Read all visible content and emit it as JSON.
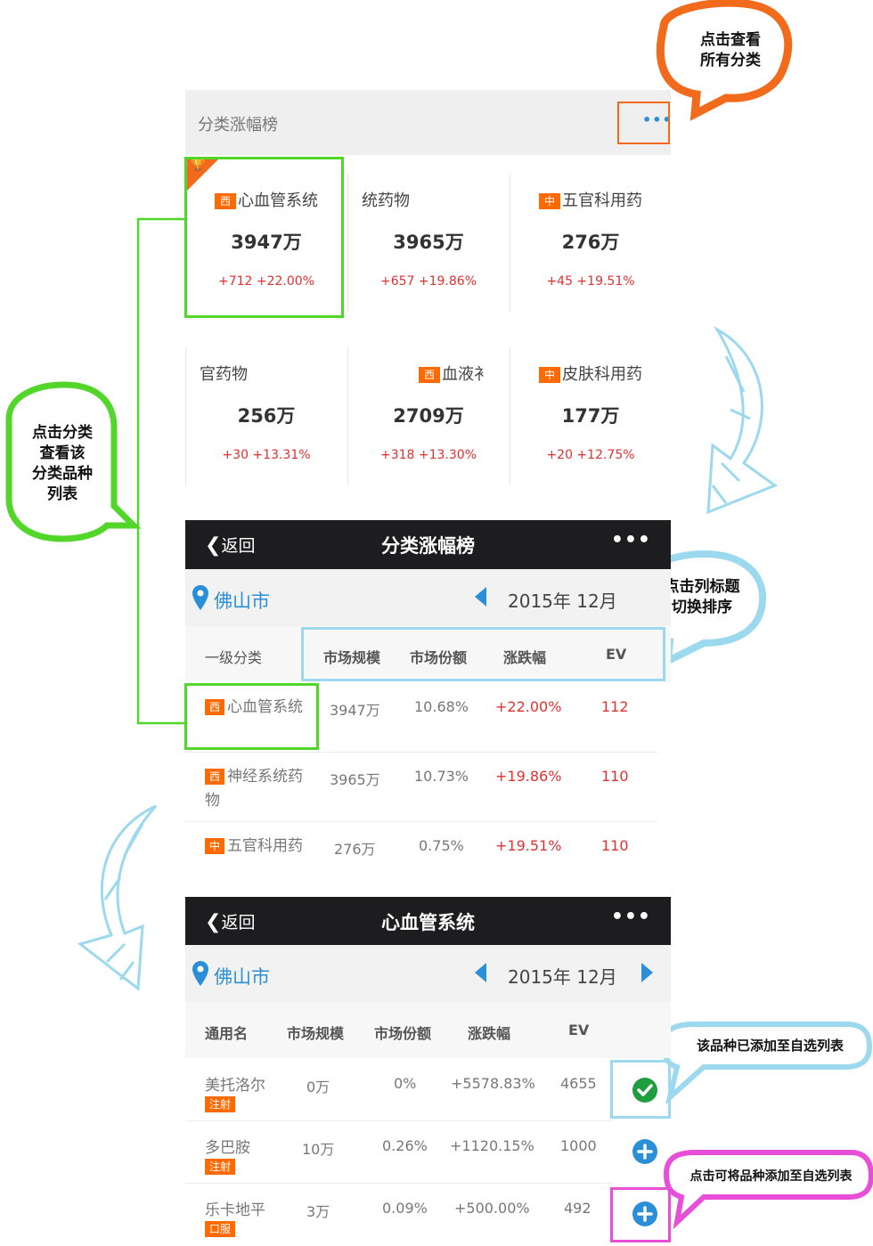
{
  "callouts": {
    "top_right": [
      "点击查看",
      "所有分类"
    ],
    "left": [
      "点击分类",
      "查看该",
      "分类品种",
      "列表"
    ],
    "col_sort": [
      "点击列标题",
      "切换排序"
    ],
    "added": "该品种已添加至自选列表",
    "add": "点击可将品种添加至自选列表"
  },
  "section1": {
    "title": "分类涨幅榜",
    "more_glyph": "•••",
    "cards": [
      {
        "tag": "西",
        "name": "心血管系统",
        "value": "3947万",
        "change": "+712  +22.00%"
      },
      {
        "tag": "",
        "name": "统药物",
        "value": "3965万",
        "change": "+657  +19.86%"
      },
      {
        "tag": "中",
        "name": "五官科用药",
        "value": "276万",
        "change": "+45  +19.51%"
      },
      {
        "tag": "",
        "name": "官药物",
        "value": "256万",
        "change": "+30  +13.31%"
      },
      {
        "tag": "西",
        "name": "血液衤",
        "value": "2709万",
        "change": "+318  +13.30%"
      },
      {
        "tag": "中",
        "name": "皮肤科用药",
        "value": "177万",
        "change": "+20  +12.75%"
      }
    ]
  },
  "section2": {
    "back": "返回",
    "title": "分类涨幅榜",
    "dots": "•••",
    "city": "佛山市",
    "month": "2015年 12月",
    "headers": [
      "一级分类",
      "市场规模",
      "市场份额",
      "涨跌幅",
      "EV"
    ],
    "rows": [
      {
        "tag": "西",
        "name": "心血管系统",
        "size": "3947万",
        "share": "10.68%",
        "change": "+22.00%",
        "ev": "112"
      },
      {
        "tag": "西",
        "name": "神经系统药物",
        "size": "3965万",
        "share": "10.73%",
        "change": "+19.86%",
        "ev": "110"
      },
      {
        "tag": "中",
        "name": "五官科用药",
        "size": "276万",
        "share": "0.75%",
        "change": "+19.51%",
        "ev": "110"
      }
    ]
  },
  "section3": {
    "back": "返回",
    "title": "心血管系统",
    "dots": "•••",
    "city": "佛山市",
    "month": "2015年 12月",
    "headers": [
      "通用名",
      "市场规模",
      "市场份额",
      "涨跌幅",
      "EV"
    ],
    "rows": [
      {
        "name": "美托洛尔",
        "form": "注射",
        "size": "0万",
        "share": "0%",
        "change": "+5578.83%",
        "ev": "4655",
        "state": "added"
      },
      {
        "name": "多巴胺",
        "form": "注射",
        "size": "10万",
        "share": "0.26%",
        "change": "+1120.15%",
        "ev": "1000",
        "state": "add"
      },
      {
        "name": "乐卡地平",
        "form": "口服",
        "size": "3万",
        "share": "0.09%",
        "change": "+500.00%",
        "ev": "492",
        "state": "add"
      }
    ]
  },
  "colors": {
    "accent": "#2b8fd7",
    "tag": "#ff6a00",
    "up": "#e03131",
    "green": "#53d62a",
    "orange": "#f26a1b",
    "cyan": "#9dd9ee",
    "magenta": "#e84fd8"
  }
}
